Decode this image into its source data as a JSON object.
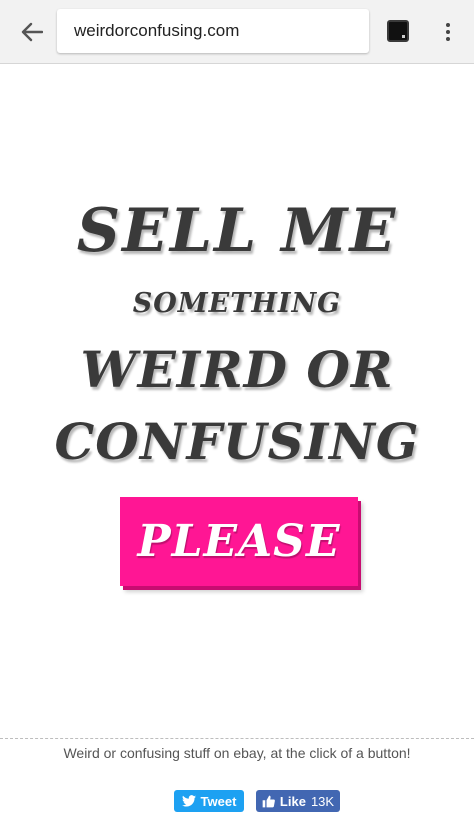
{
  "browser": {
    "url": "weirdorconfusing.com",
    "back_icon": "arrow-left-icon",
    "tabs_icon": "tab-switcher-icon",
    "menu_icon": "more-vert-icon"
  },
  "headline": {
    "line1": "SELL ME",
    "line2": "SOMETHING",
    "line3": "WEIRD OR",
    "line4": "CONFUSING"
  },
  "cta": {
    "label": "PLEASE",
    "color": "#ff1694"
  },
  "footer": {
    "tagline": "Weird or confusing stuff on ebay, at the click of a button!",
    "tweet_label": "Tweet",
    "like_label": "Like",
    "like_count": "13K",
    "twitter_color": "#1da1f2",
    "facebook_color": "#4267b2"
  }
}
